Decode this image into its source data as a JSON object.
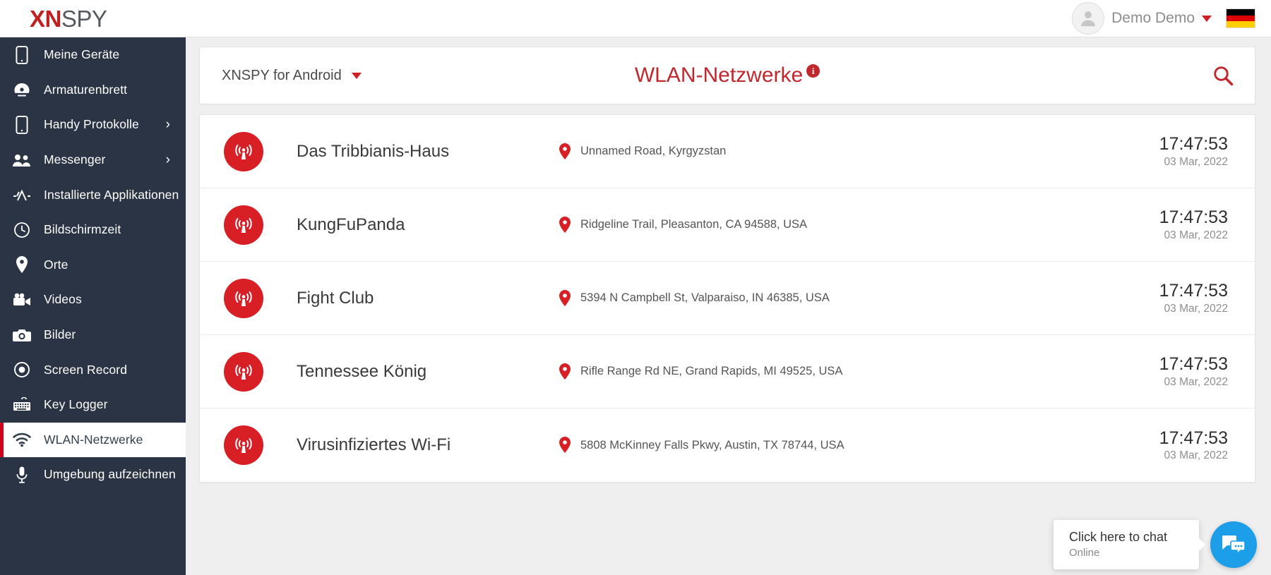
{
  "brand": {
    "logo_primary": "XN",
    "logo_secondary": "SPY",
    "accent_red": "#c1272d",
    "sidebar_bg": "#2b3444"
  },
  "topbar": {
    "avatar_icon": "user-avatar-icon",
    "user_name": "Demo Demo",
    "user_caret_icon": "caret-down-icon",
    "language_flag": "german-flag-icon"
  },
  "sidebar": {
    "items": [
      {
        "label": "Meine Geräte",
        "icon": "smartphone-icon",
        "has_chevron": false,
        "active": false
      },
      {
        "label": "Armaturenbrett",
        "icon": "dashboard-icon",
        "has_chevron": false,
        "active": false
      },
      {
        "label": "Handy Protokolle",
        "icon": "smartphone-icon",
        "has_chevron": true,
        "active": false
      },
      {
        "label": "Messenger",
        "icon": "people-icon",
        "has_chevron": true,
        "active": false
      },
      {
        "label": "Installierte Applikationen",
        "icon": "appstore-icon",
        "has_chevron": false,
        "active": false
      },
      {
        "label": "Bildschirmzeit",
        "icon": "clock-icon",
        "has_chevron": false,
        "active": false
      },
      {
        "label": "Orte",
        "icon": "map-pin-icon",
        "has_chevron": false,
        "active": false
      },
      {
        "label": "Videos",
        "icon": "video-camera-icon",
        "has_chevron": false,
        "active": false
      },
      {
        "label": "Bilder",
        "icon": "camera-icon",
        "has_chevron": false,
        "active": false
      },
      {
        "label": "Screen Record",
        "icon": "record-icon",
        "has_chevron": false,
        "active": false
      },
      {
        "label": "Key Logger",
        "icon": "keyboard-icon",
        "has_chevron": false,
        "active": false
      },
      {
        "label": "WLAN-Netzwerke",
        "icon": "wifi-icon",
        "has_chevron": false,
        "active": true
      },
      {
        "label": "Umgebung aufzeichnen",
        "icon": "microphone-icon",
        "has_chevron": false,
        "active": false
      }
    ],
    "chevron_glyph": "›"
  },
  "header": {
    "device_label": "XNSPY for Android",
    "device_caret_icon": "caret-down-icon",
    "page_title": "WLAN-Netzwerke",
    "info_badge": "i",
    "search_icon": "search-icon"
  },
  "wifi_list": {
    "location_icon": "map-pin-icon",
    "network_icon": "wifi-broadcast-icon",
    "rows": [
      {
        "name": "Das Tribbianis-Haus",
        "address": "Unnamed Road, Kyrgyzstan",
        "time": "17:47:53",
        "date": "03 Mar, 2022"
      },
      {
        "name": "KungFuPanda",
        "address": "Ridgeline Trail, Pleasanton, CA 94588, USA",
        "time": "17:47:53",
        "date": "03 Mar, 2022"
      },
      {
        "name": "Fight Club",
        "address": "5394 N Campbell St, Valparaiso, IN 46385, USA",
        "time": "17:47:53",
        "date": "03 Mar, 2022"
      },
      {
        "name": "Tennessee König",
        "address": "Rifle Range Rd NE, Grand Rapids, MI 49525, USA",
        "time": "17:47:53",
        "date": "03 Mar, 2022"
      },
      {
        "name": "Virusinfiziertes Wi-Fi",
        "address": "5808 McKinney Falls Pkwy, Austin, TX 78744, USA",
        "time": "17:47:53",
        "date": "03 Mar, 2022"
      }
    ]
  },
  "chat_widget": {
    "title": "Click here to chat",
    "status": "Online",
    "icon": "chat-bubbles-icon",
    "color": "#1c9fe8"
  }
}
